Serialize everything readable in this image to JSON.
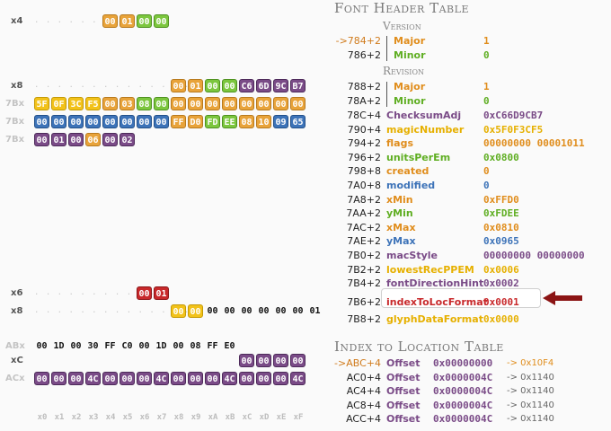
{
  "hex_view": {
    "row_labels": [
      "x4",
      "x8",
      "7Bx",
      "7Bx",
      "7Bx",
      "x6",
      "x8",
      "ABx",
      "xC",
      "ACx"
    ],
    "col_ticks": [
      "x0",
      "x1",
      "x2",
      "x3",
      "x4",
      "x5",
      "x6",
      "x7",
      "x8",
      "x9",
      "xA",
      "xB",
      "xC",
      "xD",
      "xE",
      "xF"
    ],
    "rows": [
      {
        "label_idx": 0,
        "bytes": [
          {
            "v": "00",
            "c": "org"
          },
          {
            "v": "01",
            "c": "org"
          },
          {
            "v": "00",
            "c": "grn"
          },
          {
            "v": "00",
            "c": "grn"
          }
        ]
      },
      {
        "label_idx": 1,
        "bytes": [
          {
            "v": "00",
            "c": "org"
          },
          {
            "v": "01",
            "c": "org"
          },
          {
            "v": "00",
            "c": "grn"
          },
          {
            "v": "00",
            "c": "grn"
          },
          {
            "v": "C6",
            "c": "pur"
          },
          {
            "v": "6D",
            "c": "pur"
          },
          {
            "v": "9C",
            "c": "pur"
          },
          {
            "v": "B7",
            "c": "pur"
          }
        ]
      },
      {
        "label_idx": 2,
        "bytes": [
          {
            "v": "5F",
            "c": "yel"
          },
          {
            "v": "0F",
            "c": "yel"
          },
          {
            "v": "3C",
            "c": "yel"
          },
          {
            "v": "F5",
            "c": "yel"
          },
          {
            "v": "00",
            "c": "org"
          },
          {
            "v": "03",
            "c": "org"
          },
          {
            "v": "08",
            "c": "grn"
          },
          {
            "v": "00",
            "c": "grn"
          },
          {
            "v": "00",
            "c": "org"
          },
          {
            "v": "00",
            "c": "org"
          },
          {
            "v": "00",
            "c": "org"
          },
          {
            "v": "00",
            "c": "org"
          },
          {
            "v": "00",
            "c": "org"
          },
          {
            "v": "00",
            "c": "org"
          },
          {
            "v": "00",
            "c": "org"
          },
          {
            "v": "00",
            "c": "org"
          }
        ]
      },
      {
        "label_idx": 3,
        "bytes": [
          {
            "v": "00",
            "c": "blu"
          },
          {
            "v": "00",
            "c": "blu"
          },
          {
            "v": "00",
            "c": "blu"
          },
          {
            "v": "00",
            "c": "blu"
          },
          {
            "v": "00",
            "c": "blu"
          },
          {
            "v": "00",
            "c": "blu"
          },
          {
            "v": "00",
            "c": "blu"
          },
          {
            "v": "00",
            "c": "blu"
          },
          {
            "v": "FF",
            "c": "org"
          },
          {
            "v": "D0",
            "c": "org"
          },
          {
            "v": "FD",
            "c": "grn"
          },
          {
            "v": "EE",
            "c": "grn"
          },
          {
            "v": "08",
            "c": "org"
          },
          {
            "v": "10",
            "c": "org"
          },
          {
            "v": "09",
            "c": "blu"
          },
          {
            "v": "65",
            "c": "blu"
          }
        ]
      },
      {
        "label_idx": 4,
        "bytes": [
          {
            "v": "00",
            "c": "pur"
          },
          {
            "v": "01",
            "c": "pur"
          },
          {
            "v": "00",
            "c": "pur"
          },
          {
            "v": "06",
            "c": "org"
          },
          {
            "v": "00",
            "c": "pur"
          },
          {
            "v": "02",
            "c": "pur"
          }
        ]
      },
      {
        "label_idx": 5,
        "bytes": [
          {
            "v": "00",
            "c": "red"
          },
          {
            "v": "01",
            "c": "red"
          }
        ]
      },
      {
        "label_idx": 6,
        "bytes": [
          {
            "v": "00",
            "c": "yel"
          },
          {
            "v": "00",
            "c": "yel"
          },
          {
            "v": "00",
            "c": "plain"
          },
          {
            "v": "00",
            "c": "plain"
          },
          {
            "v": "00",
            "c": "plain"
          },
          {
            "v": "00",
            "c": "plain"
          },
          {
            "v": "00",
            "c": "plain"
          },
          {
            "v": "00",
            "c": "plain"
          },
          {
            "v": "01",
            "c": "plain"
          }
        ]
      },
      {
        "label_idx": 7,
        "bytes": [
          {
            "v": "00",
            "c": "plain"
          },
          {
            "v": "1D",
            "c": "plain"
          },
          {
            "v": "00",
            "c": "plain"
          },
          {
            "v": "30",
            "c": "plain"
          },
          {
            "v": "FF",
            "c": "plain"
          },
          {
            "v": "C0",
            "c": "plain"
          },
          {
            "v": "00",
            "c": "plain"
          },
          {
            "v": "1D",
            "c": "plain"
          },
          {
            "v": "00",
            "c": "plain"
          },
          {
            "v": "08",
            "c": "plain"
          },
          {
            "v": "FF",
            "c": "plain"
          },
          {
            "v": "E0",
            "c": "plain"
          }
        ]
      },
      {
        "label_idx": 8,
        "bytes": [
          {
            "v": "00",
            "c": "pur"
          },
          {
            "v": "00",
            "c": "pur"
          },
          {
            "v": "00",
            "c": "pur"
          },
          {
            "v": "00",
            "c": "pur"
          }
        ]
      },
      {
        "label_idx": 9,
        "bytes": [
          {
            "v": "00",
            "c": "pur"
          },
          {
            "v": "00",
            "c": "pur"
          },
          {
            "v": "00",
            "c": "pur"
          },
          {
            "v": "4C",
            "c": "pur"
          },
          {
            "v": "00",
            "c": "pur"
          },
          {
            "v": "00",
            "c": "pur"
          },
          {
            "v": "00",
            "c": "pur"
          },
          {
            "v": "4C",
            "c": "pur"
          },
          {
            "v": "00",
            "c": "pur"
          },
          {
            "v": "00",
            "c": "pur"
          },
          {
            "v": "00",
            "c": "pur"
          },
          {
            "v": "4C",
            "c": "pur"
          },
          {
            "v": "00",
            "c": "pur"
          },
          {
            "v": "00",
            "c": "pur"
          },
          {
            "v": "00",
            "c": "pur"
          },
          {
            "v": "4C",
            "c": "pur"
          }
        ]
      }
    ]
  },
  "font_header": {
    "title": "Font Header Table",
    "version_label": "Version",
    "revision_label": "Revision",
    "version": [
      {
        "addr": "->784+2",
        "name": "Major",
        "value": "1",
        "color": "org"
      },
      {
        "addr": "786+2",
        "name": "Minor",
        "value": "0",
        "color": "grn"
      }
    ],
    "revision": [
      {
        "addr": "788+2",
        "name": "Major",
        "value": "1",
        "color": "org"
      },
      {
        "addr": "78A+2",
        "name": "Minor",
        "value": "0",
        "color": "grn"
      }
    ],
    "fields": [
      {
        "addr": "78C+4",
        "name": "ChecksumAdj",
        "value": "0xC66D9CB7",
        "color": "pur"
      },
      {
        "addr": "790+4",
        "name": "magicNumber",
        "value": "0x5F0F3CF5",
        "color": "yel"
      },
      {
        "addr": "794+2",
        "name": "flags",
        "value": "00000000 00001011",
        "color": "org"
      },
      {
        "addr": "796+2",
        "name": "unitsPerEm",
        "value": "0x0800",
        "color": "grn"
      },
      {
        "addr": "798+8",
        "name": "created",
        "value": "0",
        "color": "org"
      },
      {
        "addr": "7A0+8",
        "name": "modified",
        "value": "0",
        "color": "blu"
      },
      {
        "addr": "7A8+2",
        "name": "xMin",
        "value": "0xFFD0",
        "color": "org"
      },
      {
        "addr": "7AA+2",
        "name": "yMin",
        "value": "0xFDEE",
        "color": "grn"
      },
      {
        "addr": "7AC+2",
        "name": "xMax",
        "value": "0x0810",
        "color": "org"
      },
      {
        "addr": "7AE+2",
        "name": "yMax",
        "value": "0x0965",
        "color": "blu"
      },
      {
        "addr": "7B0+2",
        "name": "macStyle",
        "value": "00000000 00000000",
        "color": "pur"
      },
      {
        "addr": "7B2+2",
        "name": "lowestRecPPEM",
        "value": "0x0006",
        "color": "yel"
      },
      {
        "addr": "7B4+2",
        "name": "fontDirectionHint",
        "value": "0x0002",
        "color": "pur"
      },
      {
        "addr": "7B6+2",
        "name": "indexToLocFormat",
        "value": "0x0001",
        "color": "red"
      },
      {
        "addr": "7B8+2",
        "name": "glyphDataFormat",
        "value": "0x0000",
        "color": "yel"
      }
    ]
  },
  "loca": {
    "title": "Index to Location Table",
    "entries": [
      {
        "addr": "->ABC+4",
        "name": "Offset",
        "value": "0x00000000",
        "note": "-> 0x10F4"
      },
      {
        "addr": "AC0+4",
        "name": "Offset",
        "value": "0x0000004C",
        "note": "-> 0x1140"
      },
      {
        "addr": "AC4+4",
        "name": "Offset",
        "value": "0x0000004C",
        "note": "-> 0x1140"
      },
      {
        "addr": "AC8+4",
        "name": "Offset",
        "value": "0x0000004C",
        "note": "-> 0x1140"
      },
      {
        "addr": "ACC+4",
        "name": "Offset",
        "value": "0x0000004C",
        "note": "-> 0x1140"
      }
    ]
  },
  "colors": {
    "orange": "#e08d1c",
    "green": "#5fae22",
    "purple": "#7a4b87",
    "blue": "#3d73b8",
    "red": "#c8292b",
    "yellow": "#e6b000",
    "arrow": "#8b1414"
  }
}
